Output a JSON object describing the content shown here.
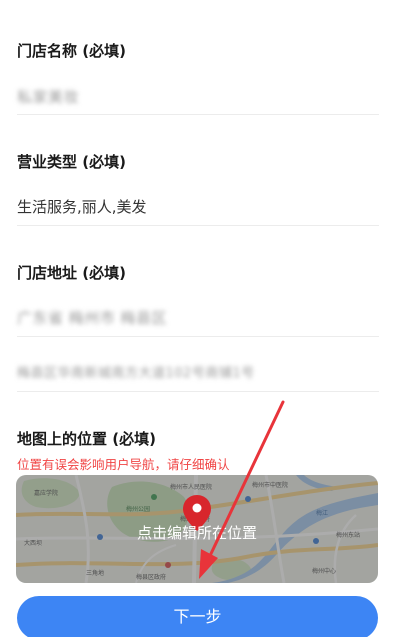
{
  "form": {
    "store_name": {
      "label": "门店名称 (必填)",
      "value": "私家美妆"
    },
    "business_type": {
      "label": "营业类型 (必填)",
      "value": "生活服务,丽人,美发"
    },
    "store_address": {
      "label": "门店地址 (必填)",
      "region": "广东省 梅州市 梅县区",
      "detail": "梅县区华南新城南方大道102号商铺1号"
    },
    "map_location": {
      "label": "地图上的位置 (必填)",
      "hint": "位置有误会影响用户导航，请仔细确认",
      "overlay_text": "点击编辑所在位置",
      "marker_color": "#d8262c",
      "map_labels": {
        "north": "梅州市中医院",
        "city_center": "梅江区政府",
        "hospital": "梅州市人民医院",
        "school": "嘉应学院",
        "park": "梅州公园",
        "district": "梅县区政府",
        "southeast": "梅州中心",
        "east": "梅州东站",
        "west": "大西坝",
        "river": "梅江",
        "area": "三角地"
      }
    }
  },
  "actions": {
    "next_label": "下一步"
  },
  "colors": {
    "primary": "#3d85f4",
    "hint": "#f04545",
    "annotation_arrow": "#e8343a"
  }
}
